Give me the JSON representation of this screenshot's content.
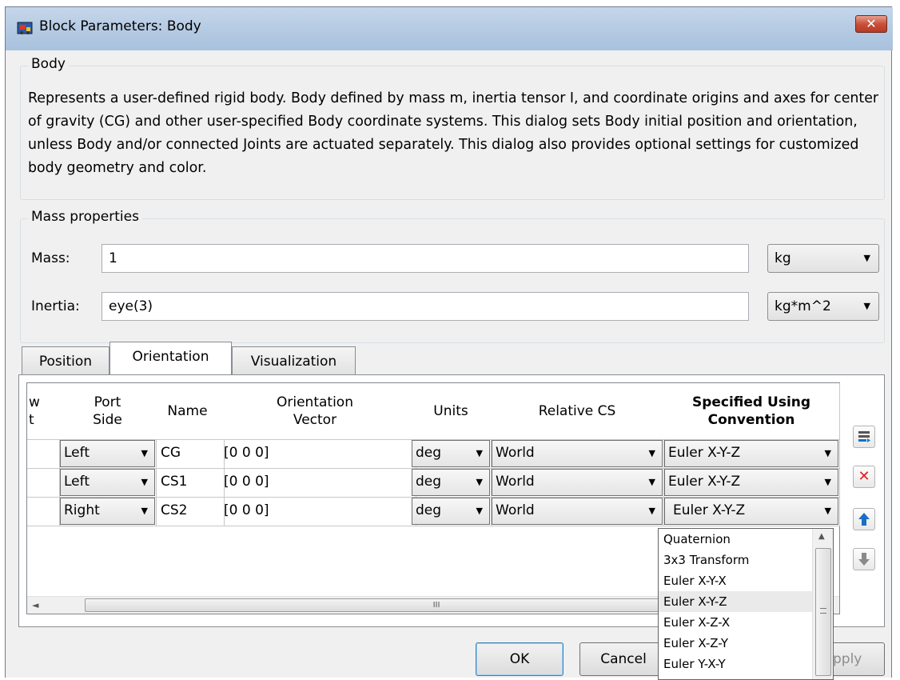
{
  "window": {
    "title": "Block Parameters: Body",
    "close_glyph": "✕"
  },
  "body_group": {
    "legend": "Body",
    "description": "Represents a user-defined rigid body. Body defined by mass m, inertia tensor I, and coordinate origins and axes for center of gravity (CG) and other user-specified Body coordinate systems. This dialog sets Body initial position and orientation, unless Body and/or connected Joints are actuated separately. This dialog also provides optional settings for customized body geometry and color."
  },
  "mass_properties": {
    "legend": "Mass properties",
    "mass_label": "Mass:",
    "mass_value": "1",
    "mass_unit": "kg",
    "inertia_label": "Inertia:",
    "inertia_value": "eye(3)",
    "inertia_unit": "kg*m^2"
  },
  "tabs": [
    {
      "label": "Position",
      "active": false
    },
    {
      "label": "Orientation",
      "active": true
    },
    {
      "label": "Visualization",
      "active": false
    }
  ],
  "table": {
    "headers": {
      "show_port": "w\nt",
      "port_side": "Port\nSide",
      "name": "Name",
      "orientation_vector": "Orientation\nVector",
      "units": "Units",
      "relative_cs": "Relative CS",
      "specified_using": "Specified Using\nConvention"
    },
    "rows": [
      {
        "port_side": "Left",
        "name": "CG",
        "orientation_vector": "[0 0 0]",
        "units": "deg",
        "relative_cs": "World",
        "convention": "Euler X-Y-Z"
      },
      {
        "port_side": "Left",
        "name": "CS1",
        "orientation_vector": "[0 0 0]",
        "units": "deg",
        "relative_cs": "World",
        "convention": "Euler X-Y-Z"
      },
      {
        "port_side": "Right",
        "name": "CS2",
        "orientation_vector": "[0 0 0]",
        "units": "deg",
        "relative_cs": "World",
        "convention": "Euler X-Y-Z"
      }
    ],
    "scroll_left_glyph": "◄",
    "scroll_thumb_glyph": "III"
  },
  "convention_dropdown": {
    "options": [
      "Quaternion",
      "3x3 Transform",
      "Euler X-Y-X",
      "Euler X-Y-Z",
      "Euler X-Z-X",
      "Euler X-Z-Y",
      "Euler Y-X-Y"
    ],
    "highlighted": "Euler X-Y-Z"
  },
  "side_buttons": {
    "add_icon": "add-row-icon",
    "delete_icon": "delete-row-icon",
    "up_icon": "move-up-icon",
    "down_icon": "move-down-icon"
  },
  "buttons": {
    "ok": "OK",
    "cancel": "Cancel",
    "apply": "pply"
  },
  "colors": {
    "titlebar": "#b3c9e2",
    "close": "#c9503a",
    "delete": "#e02020",
    "arrow_blue": "#1a6fc4"
  }
}
